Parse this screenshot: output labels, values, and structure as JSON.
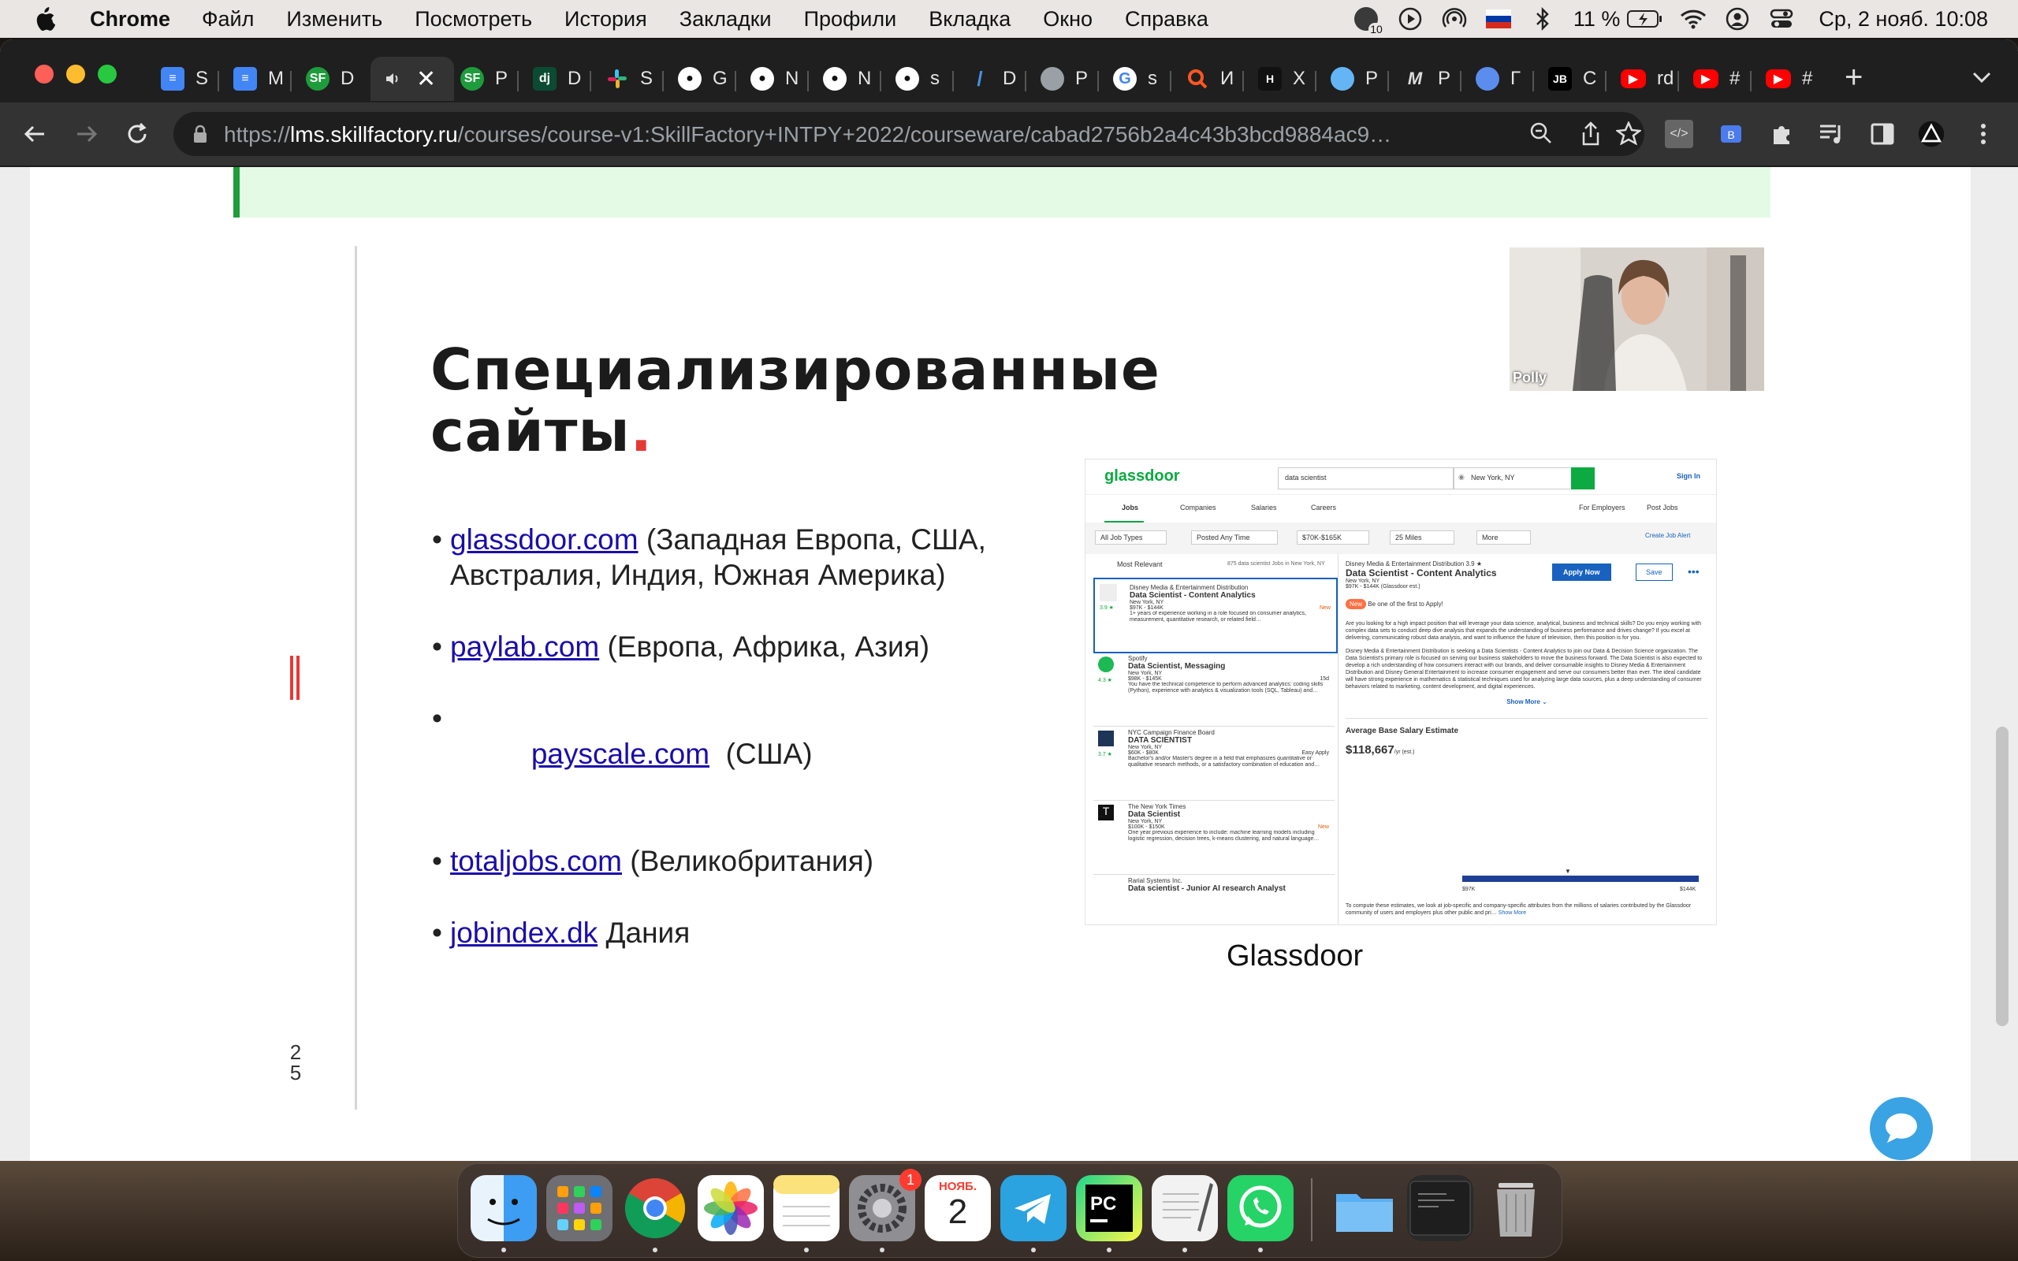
{
  "menubar": {
    "app_name": "Chrome",
    "items": [
      "Файл",
      "Изменить",
      "Посмотреть",
      "История",
      "Закладки",
      "Профили",
      "Вкладка",
      "Окно",
      "Справка"
    ],
    "notification_count": "10",
    "battery_percent": "11 %",
    "datetime": "Ср, 2 нояб.  10:08"
  },
  "browser": {
    "tabs": [
      {
        "label": "S",
        "favicon": "google-docs-icon",
        "color": "#4285f4"
      },
      {
        "label": "M",
        "favicon": "google-docs-icon",
        "color": "#4285f4"
      },
      {
        "label": "D",
        "favicon": "skillfactory-icon",
        "color": "#1e9c3c"
      },
      {
        "label": "",
        "favicon": "speaker-icon",
        "color": "#333333"
      },
      {
        "label": "P",
        "favicon": "skillfactory-icon",
        "color": "#1e9c3c"
      },
      {
        "label": "D",
        "favicon": "django-icon",
        "color": "#0c4b33"
      },
      {
        "label": "S",
        "favicon": "slack-icon",
        "color": "#e01e5a"
      },
      {
        "label": "G",
        "favicon": "github-icon",
        "color": "#ffffff"
      },
      {
        "label": "N",
        "favicon": "github-icon",
        "color": "#ffffff"
      },
      {
        "label": "N",
        "favicon": "github-icon",
        "color": "#ffffff"
      },
      {
        "label": "s",
        "favicon": "github-icon",
        "color": "#ffffff"
      },
      {
        "label": "D",
        "favicon": "slash-icon",
        "color": "#4a90e2"
      },
      {
        "label": "P",
        "favicon": "globe-icon",
        "color": "#9aa0a6"
      },
      {
        "label": "s",
        "favicon": "google-icon",
        "color": "#ffffff"
      },
      {
        "label": "И",
        "favicon": "search-orange-icon",
        "color": "#ff5722"
      },
      {
        "label": "X",
        "favicon": "hh-icon",
        "color": "#111111"
      },
      {
        "label": "P",
        "favicon": "sun-icon",
        "color": "#64b5f6"
      },
      {
        "label": "P",
        "favicon": "m-icon",
        "color": "#333333"
      },
      {
        "label": "Г",
        "favicon": "compass-icon",
        "color": "#5b8def"
      },
      {
        "label": "C",
        "favicon": "jb-icon",
        "color": "#000000"
      },
      {
        "label": "rd",
        "favicon": "youtube-icon",
        "color": "#ff0000"
      },
      {
        "label": "#",
        "favicon": "youtube-icon",
        "color": "#ff0000"
      },
      {
        "label": "#",
        "favicon": "youtube-icon",
        "color": "#ff0000"
      }
    ],
    "url_scheme": "https://",
    "url_host": "lms.skillfactory.ru",
    "url_path": "/courses/course-v1:SkillFactory+INTPY+2022/courseware/cabad2756b2a4c43b3bcd9884ac9…"
  },
  "slide": {
    "title_line1": "Специализированные",
    "title_line2": "сайты",
    "title_dot": ".",
    "page_number_line1": "2",
    "page_number_line2": "5",
    "sites": [
      {
        "link": "glassdoor.com",
        "desc": " (Западная Европа, США, Австралия, Индия, Южная Америка)"
      },
      {
        "link": "paylab.com",
        "desc": " (Европа, Африка, Азия)"
      },
      {
        "link": "payscale.com",
        "desc": "  (США)"
      },
      {
        "link": "totaljobs.com",
        "desc": " (Великобритания)"
      },
      {
        "link": "jobindex.dk",
        "desc": " Дания"
      }
    ],
    "video_name": "Polly",
    "image_caption": "Glassdoor"
  },
  "glassdoor": {
    "logo": "glassdoor",
    "search_value": "data scientist",
    "location_value": "New York, NY",
    "signin": "Sign In",
    "nav": [
      "Jobs",
      "Companies",
      "Salaries",
      "Careers"
    ],
    "nav_right": [
      "For Employers",
      "Post Jobs"
    ],
    "filters": [
      "All Job Types",
      "Posted Any Time",
      "$70K-$165K",
      "25 Miles",
      "More"
    ],
    "create_alert": "Create Job Alert",
    "sort": "Most Relevant",
    "count": "875 data scientist Jobs in New York, NY",
    "jobs": [
      {
        "company": "Disney Media & Entertainment Distribution",
        "title": "Data Scientist - Content Analytics",
        "loc": "New York, NY",
        "rating": "3.9 ★",
        "salary": "$97K - $144K",
        "tag": "New",
        "desc": "1+ years of experience working in a role focused on consumer analytics, measurement, quantitative research, or related field…"
      },
      {
        "company": "Spotify",
        "title": "Data Scientist, Messaging",
        "loc": "New York, NY",
        "rating": "4.3 ★",
        "salary": "$98K - $145K",
        "tag": "15d",
        "desc": "You have the technical competence to perform advanced analytics: coding skills (Python), experience with analytics & visualization tools (SQL, Tableau) and…"
      },
      {
        "company": "NYC Campaign Finance Board",
        "title": "DATA SCIENTIST",
        "loc": "New York, NY",
        "rating": "3.7 ★",
        "salary": "$60K - $80K",
        "tag": "Easy Apply",
        "desc": "Bachelor's and/or Master's degree in a field that emphasizes quantitative or qualitative research methods, or a satisfactory combination of education and…"
      },
      {
        "company": "The New York Times",
        "title": "Data Scientist",
        "loc": "New York, NY",
        "rating": "",
        "salary": "$100K - $150K",
        "tag": "New",
        "desc": "One year previous experience to include: machine learning models including logistic regression, decision trees, k-means clustering, and natural language…"
      },
      {
        "company": "Rarial Systems Inc.",
        "title": "Data scientist - Junior AI research Analyst",
        "loc": "",
        "rating": "",
        "salary": "",
        "tag": "",
        "desc": ""
      }
    ],
    "detail": {
      "company": "Disney Media & Entertainment Distribution 3.9 ★",
      "title": "Data Scientist - Content Analytics",
      "loc": "New York, NY",
      "salary": "$97K - $144K (Glassdoor est.)",
      "apply": "Apply Now",
      "save": "Save",
      "new_badge": "New",
      "early": "Be one of the first to Apply!",
      "para1": "Are you looking for a high impact position that will leverage your data science, analytical, business and technical skills? Do you enjoy working with complex data sets to conduct deep dive analysis that expands the understanding of business performance and drives change? If you excel at delivering, communicating robust data analysis, and want to influence the future of television, then this position is for you.",
      "para2": "Disney Media & Entertainment Distribution is seeking a Data Scientists - Content Analytics to join our Data & Decision Science organization. The Data Scientist's primary role is focused on serving our business stakeholders to move the business forward. The Data Scientist is also expected to develop a rich understanding of how consumers interact with our brands, and deliver consumable insights to Disney Media & Entertainment Distribution and Disney General Entertainment to increase consumer engagement and serve our consumers better than ever. The ideal candidate will have strong experience in mathematics & statistical techniques used for analyzing large data sources, plus a deep understanding of consumer behaviors related to marketing, content development, and digital experiences.",
      "show_more": "Show More ⌄",
      "avg_title": "Average Base Salary Estimate",
      "avg_value": "$118,667",
      "avg_unit": "/yr (est.)",
      "range_low": "$97K",
      "range_high": "$144K",
      "footer": "To compute these estimates, we look at job-specific and company-specific attributes from the millions of salaries contributed by the Glassdoor community of users and employers plus other public and pri…",
      "footer_more": "Show More"
    }
  },
  "dock": {
    "apps": [
      {
        "name": "Finder",
        "color": "#3d9df3"
      },
      {
        "name": "Launchpad",
        "color": "#8e8e93"
      },
      {
        "name": "Chrome",
        "color": "#ffffff"
      },
      {
        "name": "Photos",
        "color": "#ffffff"
      },
      {
        "name": "Notes",
        "color": "#fbe27a"
      },
      {
        "name": "System Settings",
        "color": "#8e8e93"
      },
      {
        "name": "Calendar",
        "color": "#ffffff"
      },
      {
        "name": "Telegram",
        "color": "#2aa3e0"
      },
      {
        "name": "PyCharm",
        "color": "#21d789"
      },
      {
        "name": "TextEdit",
        "color": "#f2f2f2"
      },
      {
        "name": "WhatsApp",
        "color": "#25d366"
      },
      {
        "name": "Folder",
        "color": "#5ab0f5"
      },
      {
        "name": "Terminal",
        "color": "#2a2a2a"
      },
      {
        "name": "Trash",
        "color": "#b0b0b0"
      }
    ],
    "settings_badge": "1",
    "calendar_month": "НОЯБ.",
    "calendar_day": "2"
  }
}
